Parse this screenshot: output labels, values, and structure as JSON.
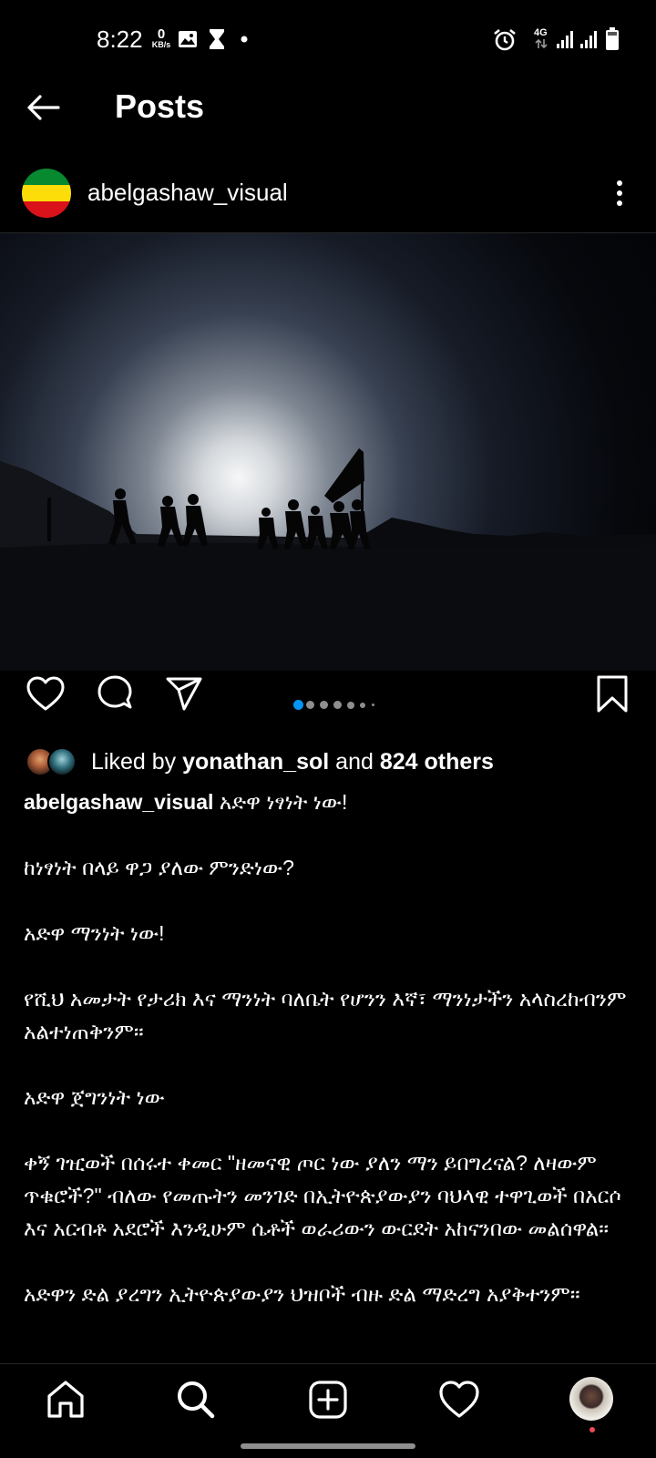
{
  "status_bar": {
    "time": "8:22",
    "net_speed_value": "0",
    "net_speed_unit": "KB/s",
    "network_label": "4G"
  },
  "header": {
    "title": "Posts"
  },
  "post": {
    "username": "abelgashaw_visual",
    "avatar_colors": [
      "#078930",
      "#FCDD09",
      "#DA121A"
    ],
    "carousel": {
      "total": 7,
      "active_index": 0,
      "active_color": "#0095F6"
    },
    "likes": {
      "prefix": "Liked by ",
      "user": "yonathan_sol",
      "middle": " and ",
      "count_text": "824 others"
    },
    "caption": {
      "username": "abelgashaw_visual",
      "first_line": " አድዋ ነፃነት ነው!",
      "paragraphs": [
        "ከነፃነት በላይ ዋጋ ያለው ምንድነው?",
        "አድዋ ማንነት ነው!",
        "የሺህ አመታት የታሪክ እና ማንነት ባለቤት የሆንን እኛ፣ ማንነታችን አላስረከብንም አልተነጠቅንም።",
        "አድዋ ጀግንነት ነው",
        "ቀኝ ገዢወች በሰሩተ ቀመር \"ዘመናዊ ጦር ነው ያለን ማን ይበግረናል? ለዛውም ጥቁሮች?\" ብለው የመጡትን መንገድ በኢትዮጵያውያን ባህላዊ ተዋጊወች በአርሶ እና አርብቶ አደሮች እንዲሁም ሴቶች ወራሪውን ውርደት አከናንበው መልሰዋል።",
        "አድዋን ድል ያረግን ኢትዮጵያውያን ህዝቦች ብዙ ድል ማድረግ አያቅተንም።"
      ]
    }
  },
  "colors": {
    "background": "#000000",
    "text": "#FFFFFF",
    "muted": "#8E8E8E",
    "notification": "#ED4956"
  },
  "icons": {
    "back": "arrow-left-icon",
    "more": "more-vertical-icon",
    "like": "heart-outline-icon",
    "comment": "comment-bubble-icon",
    "share": "paper-plane-icon",
    "save": "bookmark-outline-icon",
    "nav": [
      "home-icon",
      "search-icon",
      "add-post-icon",
      "activity-heart-icon",
      "profile-avatar"
    ]
  }
}
